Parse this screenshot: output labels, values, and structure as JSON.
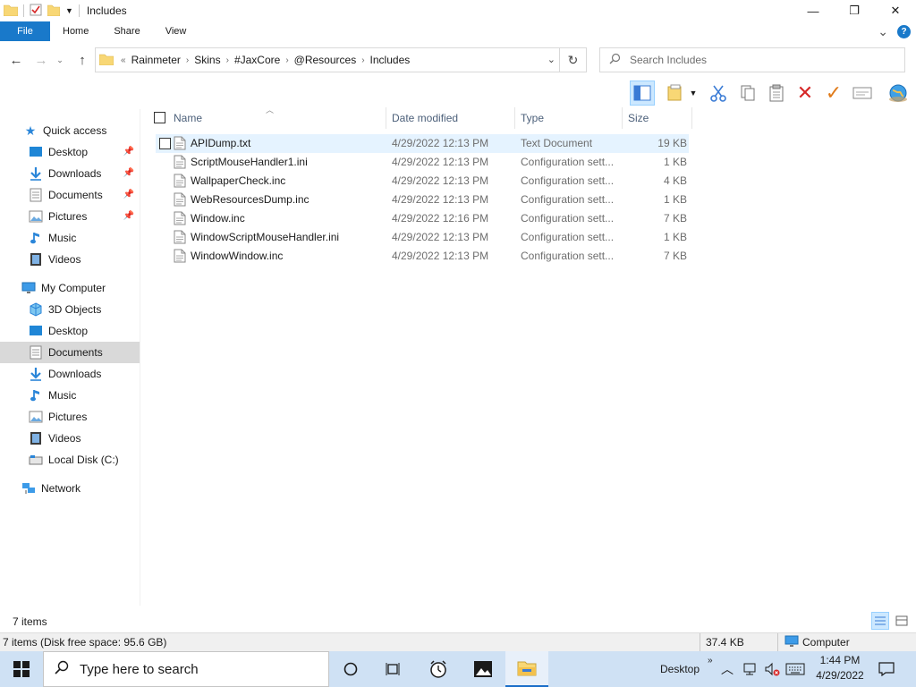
{
  "window": {
    "title": "Includes",
    "controls": {
      "minimize": "—",
      "maximize": "❐",
      "close": "✕"
    }
  },
  "ribbon": {
    "tabs": [
      {
        "label": "File"
      },
      {
        "label": "Home"
      },
      {
        "label": "Share"
      },
      {
        "label": "View"
      }
    ],
    "expand_glyph": "⌄",
    "help_glyph": "?"
  },
  "address": {
    "prefix": "«",
    "crumbs": [
      "Rainmeter",
      "Skins",
      "#JaxCore",
      "@Resources",
      "Includes"
    ],
    "dropdown_glyph": "⌄",
    "refresh_glyph": "↻"
  },
  "search": {
    "placeholder": "Search Includes"
  },
  "nav": {
    "quick_access": {
      "label": "Quick access",
      "items": [
        {
          "label": "Desktop",
          "icon": "desktop-icon",
          "pinned": true
        },
        {
          "label": "Downloads",
          "icon": "downloads-icon",
          "pinned": true
        },
        {
          "label": "Documents",
          "icon": "documents-icon",
          "pinned": true
        },
        {
          "label": "Pictures",
          "icon": "pictures-icon",
          "pinned": true
        },
        {
          "label": "Music",
          "icon": "music-icon",
          "pinned": false
        },
        {
          "label": "Videos",
          "icon": "videos-icon",
          "pinned": false
        }
      ]
    },
    "computer": {
      "label": "My Computer",
      "items": [
        {
          "label": "3D Objects",
          "icon": "3d-objects-icon"
        },
        {
          "label": "Desktop",
          "icon": "desktop-icon"
        },
        {
          "label": "Documents",
          "icon": "documents-icon",
          "selected": true
        },
        {
          "label": "Downloads",
          "icon": "downloads-icon"
        },
        {
          "label": "Music",
          "icon": "music-icon"
        },
        {
          "label": "Pictures",
          "icon": "pictures-icon"
        },
        {
          "label": "Videos",
          "icon": "videos-icon"
        },
        {
          "label": "Local Disk (C:)",
          "icon": "drive-icon"
        }
      ]
    },
    "network": {
      "label": "Network"
    }
  },
  "columns": {
    "name": "Name",
    "date": "Date modified",
    "type": "Type",
    "size": "Size"
  },
  "files": [
    {
      "name": "APIDump.txt",
      "date": "4/29/2022 12:13 PM",
      "type": "Text Document",
      "size": "19 KB"
    },
    {
      "name": "ScriptMouseHandler1.ini",
      "date": "4/29/2022 12:13 PM",
      "type": "Configuration sett...",
      "size": "1 KB"
    },
    {
      "name": "WallpaperCheck.inc",
      "date": "4/29/2022 12:13 PM",
      "type": "Configuration sett...",
      "size": "4 KB"
    },
    {
      "name": "WebResourcesDump.inc",
      "date": "4/29/2022 12:13 PM",
      "type": "Configuration sett...",
      "size": "1 KB"
    },
    {
      "name": "Window.inc",
      "date": "4/29/2022 12:16 PM",
      "type": "Configuration sett...",
      "size": "7 KB"
    },
    {
      "name": "WindowScriptMouseHandler.ini",
      "date": "4/29/2022 12:13 PM",
      "type": "Configuration sett...",
      "size": "1 KB"
    },
    {
      "name": "WindowWindow.inc",
      "date": "4/29/2022 12:13 PM",
      "type": "Configuration sett...",
      "size": "7 KB"
    }
  ],
  "status": {
    "items_count": "7 items",
    "detail": "7 items (Disk free space: 95.6 GB)",
    "size_total": "37.4 KB",
    "location": "Computer"
  },
  "taskbar": {
    "search_placeholder": "Type here to search",
    "desktop_label": "Desktop",
    "tray_chevron": "»",
    "time": "1:44 PM",
    "date": "4/29/2022"
  },
  "colors": {
    "accent": "#1979ca",
    "selection": "#cce8ff",
    "hover_row": "#e5f3ff",
    "taskbar": "#cfe1f4",
    "folder": "#f8d775",
    "delete_red": "#d62828",
    "check_orange": "#e07b1a"
  }
}
